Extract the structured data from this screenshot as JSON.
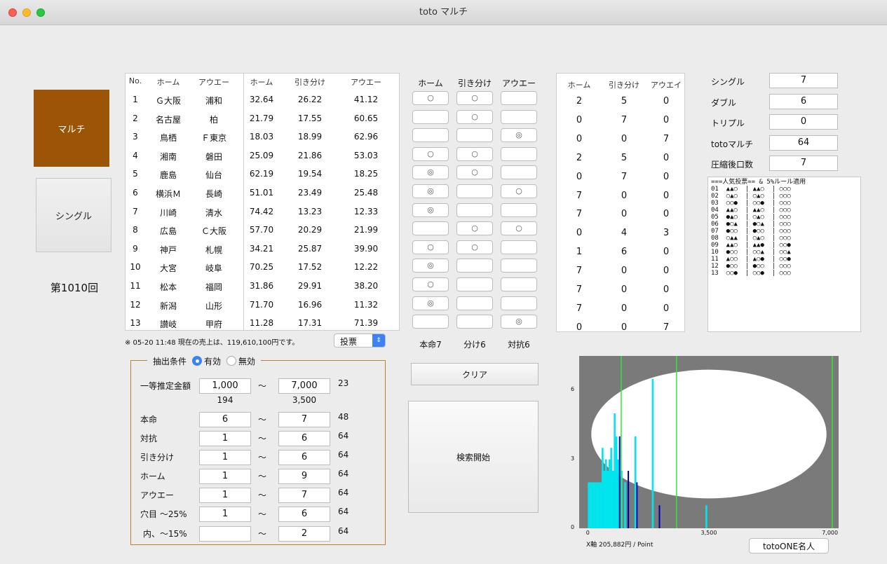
{
  "window": {
    "title": "toto マルチ"
  },
  "nav": {
    "multi_label": "マルチ",
    "single_label": "シングル",
    "round_label": "第1010回"
  },
  "table": {
    "headers": [
      "No.",
      "ホーム",
      "アウエー",
      "ホーム",
      "引き分け",
      "アウエー"
    ],
    "rows": [
      {
        "no": "1",
        "home": "Ｇ大阪",
        "away": "浦和",
        "h": "32.64",
        "d": "26.22",
        "a": "41.12"
      },
      {
        "no": "2",
        "home": "名古屋",
        "away": "柏",
        "h": "21.79",
        "d": "17.55",
        "a": "60.65"
      },
      {
        "no": "3",
        "home": "鳥栖",
        "away": "Ｆ東京",
        "h": "18.03",
        "d": "18.99",
        "a": "62.96"
      },
      {
        "no": "4",
        "home": "湘南",
        "away": "磐田",
        "h": "25.09",
        "d": "21.86",
        "a": "53.03"
      },
      {
        "no": "5",
        "home": "鹿島",
        "away": "仙台",
        "h": "62.19",
        "d": "19.54",
        "a": "18.25"
      },
      {
        "no": "6",
        "home": "横浜Ｍ",
        "away": "長崎",
        "h": "51.01",
        "d": "23.49",
        "a": "25.48"
      },
      {
        "no": "7",
        "home": "川崎",
        "away": "清水",
        "h": "74.42",
        "d": "13.23",
        "a": "12.33"
      },
      {
        "no": "8",
        "home": "広島",
        "away": "Ｃ大阪",
        "h": "57.70",
        "d": "20.29",
        "a": "21.99"
      },
      {
        "no": "9",
        "home": "神戸",
        "away": "札幌",
        "h": "34.21",
        "d": "25.87",
        "a": "39.90"
      },
      {
        "no": "10",
        "home": "大宮",
        "away": "岐阜",
        "h": "70.25",
        "d": "17.52",
        "a": "12.22"
      },
      {
        "no": "11",
        "home": "松本",
        "away": "福岡",
        "h": "31.86",
        "d": "29.91",
        "a": "38.20"
      },
      {
        "no": "12",
        "home": "新潟",
        "away": "山形",
        "h": "71.70",
        "d": "16.96",
        "a": "11.32"
      },
      {
        "no": "13",
        "home": "讃岐",
        "away": "甲府",
        "h": "11.28",
        "d": "17.31",
        "a": "71.39"
      }
    ],
    "sales_note": "※ 05-20 11:48 現在の売上は、119,610,100円です。",
    "vote_select": "投票"
  },
  "picks": {
    "headers": [
      "ホーム",
      "引き分け",
      "アウエー"
    ],
    "rows": [
      [
        "○",
        "○",
        ""
      ],
      [
        "",
        "○",
        ""
      ],
      [
        "",
        "",
        "◎"
      ],
      [
        "○",
        "○",
        ""
      ],
      [
        "◎",
        "○",
        ""
      ],
      [
        "◎",
        "",
        "○"
      ],
      [
        "◎",
        "",
        ""
      ],
      [
        "",
        "○",
        "○"
      ],
      [
        "○",
        "○",
        ""
      ],
      [
        "◎",
        "",
        ""
      ],
      [
        "○",
        "",
        ""
      ],
      [
        "◎",
        "",
        ""
      ],
      [
        "",
        "",
        "◎"
      ]
    ],
    "summary": [
      "本命7",
      "分け6",
      "対抗6"
    ],
    "clear_label": "クリア",
    "search_label": "検索開始"
  },
  "counts": {
    "headers": [
      "ホーム",
      "引き分け",
      "アウエイ"
    ],
    "rows": [
      [
        "2",
        "5",
        "0"
      ],
      [
        "0",
        "7",
        "0"
      ],
      [
        "0",
        "0",
        "7"
      ],
      [
        "2",
        "5",
        "0"
      ],
      [
        "0",
        "7",
        "0"
      ],
      [
        "7",
        "0",
        "0"
      ],
      [
        "7",
        "0",
        "0"
      ],
      [
        "0",
        "4",
        "3"
      ],
      [
        "1",
        "6",
        "0"
      ],
      [
        "7",
        "0",
        "0"
      ],
      [
        "7",
        "0",
        "0"
      ],
      [
        "7",
        "0",
        "0"
      ],
      [
        "0",
        "0",
        "7"
      ]
    ]
  },
  "stats": [
    {
      "label": "シングル",
      "value": "7"
    },
    {
      "label": "ダブル",
      "value": "6"
    },
    {
      "label": "トリプル",
      "value": "0"
    },
    {
      "label": "totoマルチ",
      "value": "64"
    },
    {
      "label": "圧縮後口数",
      "value": "7"
    }
  ],
  "popular": {
    "header": "===人気投票== & 5%ルール適用",
    "lines": [
      "01  ▲▲○  | ▲▲○  | ○○○",
      "02  ○▲○  | ○▲○  | ○○○",
      "03  ○○●  | ○○●  | ○○○",
      "04  ▲▲○  | ▲▲○  | ○○○",
      "05  ●▲○  | ○▲○  | ○○○",
      "06  ●○▲  | ●○▲  | ○○○",
      "07  ●○○  | ●○○  | ○○○",
      "08  ○▲▲  | ○▲○  | ○○○",
      "09  ▲▲○  | ▲▲●  | ○○●",
      "10  ●○○  | ○○▲  | ○○▲",
      "11  ▲○○  | ▲○●  | ○○●",
      "12  ●○○  | ●○○  | ○○○",
      "13  ○○●  | ○○●  | ○○○"
    ]
  },
  "conditions": {
    "legend": "抽出条件",
    "radio_on": "有効",
    "radio_off": "無効",
    "tilde": "〜",
    "rows": [
      {
        "label": "一等推定金額",
        "min": "1,000",
        "max": "7,000",
        "count": "23",
        "sub_min": "194",
        "sub_max": "3,500"
      },
      {
        "label": "本命",
        "min": "6",
        "max": "7",
        "count": "48"
      },
      {
        "label": "対抗",
        "min": "1",
        "max": "6",
        "count": "64"
      },
      {
        "label": "引き分け",
        "min": "1",
        "max": "6",
        "count": "64"
      },
      {
        "label": "ホーム",
        "min": "1",
        "max": "9",
        "count": "64"
      },
      {
        "label": "アウエー",
        "min": "1",
        "max": "7",
        "count": "64"
      },
      {
        "label": "穴目 〜25%",
        "min": "1",
        "max": "6",
        "count": "64"
      },
      {
        "label": "内、〜15%",
        "min": "",
        "max": "2",
        "count": "64"
      }
    ]
  },
  "chart_data": {
    "type": "bar",
    "ylim": [
      0,
      7.5
    ],
    "xlim": [
      -250,
      7250
    ],
    "y_ticks": [
      "0",
      "3",
      "6"
    ],
    "x_ticks": [
      "0",
      "3,500",
      "7,000"
    ],
    "x_note": "X軸 205,882円 / Point",
    "colors": {
      "cyan": "#00e5ee",
      "blue": "#0000b0",
      "green": "#35e635",
      "bg": "#7a7a7a"
    },
    "cyan_bars": [
      {
        "x": 0,
        "y": 2
      },
      {
        "x": 50,
        "y": 2
      },
      {
        "x": 100,
        "y": 2
      },
      {
        "x": 150,
        "y": 2
      },
      {
        "x": 200,
        "y": 2
      },
      {
        "x": 250,
        "y": 2
      },
      {
        "x": 300,
        "y": 2
      },
      {
        "x": 350,
        "y": 2
      },
      {
        "x": 400,
        "y": 3.5
      },
      {
        "x": 450,
        "y": 2.5
      },
      {
        "x": 500,
        "y": 3
      },
      {
        "x": 550,
        "y": 2.5
      },
      {
        "x": 600,
        "y": 3
      },
      {
        "x": 650,
        "y": 3.5
      },
      {
        "x": 700,
        "y": 2.5
      },
      {
        "x": 750,
        "y": 5
      },
      {
        "x": 800,
        "y": 4
      },
      {
        "x": 850,
        "y": 3
      },
      {
        "x": 950,
        "y": 2.5
      },
      {
        "x": 1050,
        "y": 2
      },
      {
        "x": 1350,
        "y": 4
      },
      {
        "x": 1850,
        "y": 6.5
      },
      {
        "x": 3400,
        "y": 1
      }
    ],
    "blue_bars": [
      {
        "x": 900,
        "y": 4
      },
      {
        "x": 1150,
        "y": 2.5
      },
      {
        "x": 1400,
        "y": 2
      },
      {
        "x": 2050,
        "y": 1
      }
    ],
    "green_lines": [
      {
        "x": 950
      },
      {
        "x": 2550
      },
      {
        "x": 7050
      }
    ],
    "ellipse": {
      "cx": 3500,
      "cy": 4.1,
      "rx": 3400,
      "ry": 2.8
    }
  },
  "totoone_label": "totoONE名人"
}
